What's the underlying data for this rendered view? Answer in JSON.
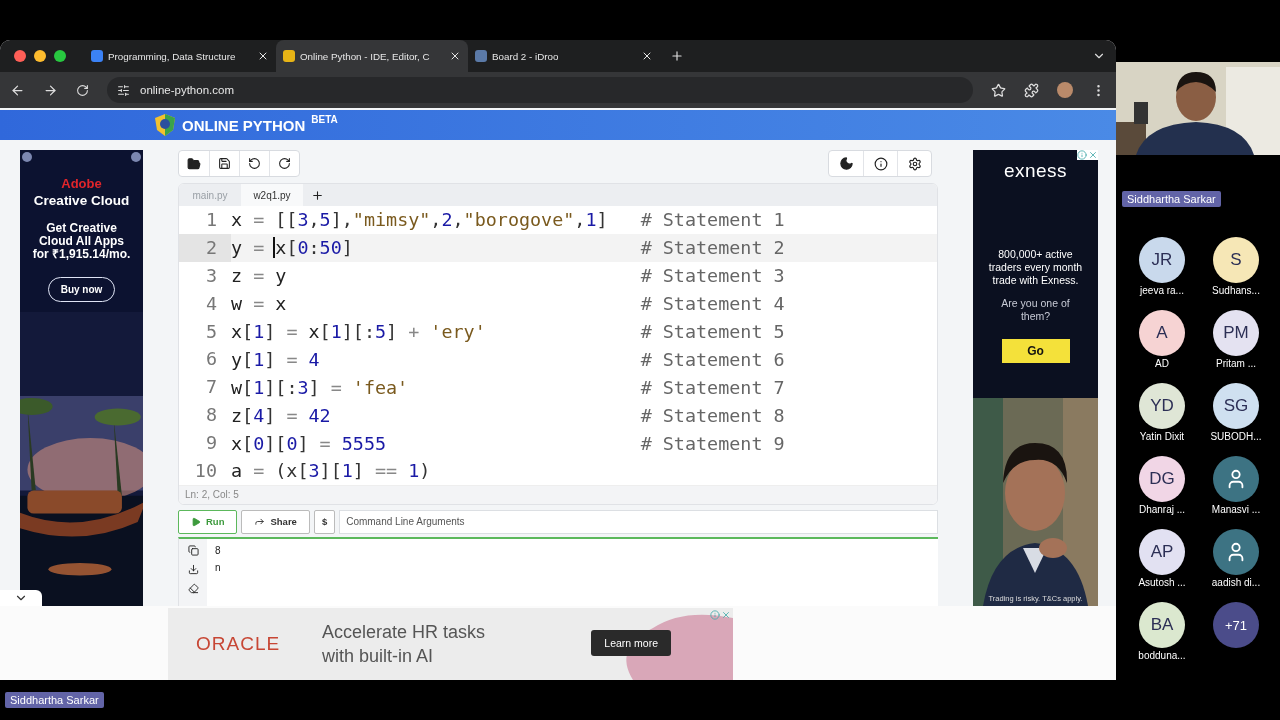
{
  "browser": {
    "tabs": [
      {
        "title": "Programming, Data Structure",
        "selected": false,
        "color": "#3b82f6"
      },
      {
        "title": "Online Python - IDE, Editor, C",
        "selected": true,
        "color": "#e7b416"
      },
      {
        "title": "Board 2 - iDroo",
        "selected": false,
        "color": "#5b7aa8"
      }
    ],
    "url": "online-python.com"
  },
  "site": {
    "brand": "ONLINE PYTHON",
    "badge": "BETA"
  },
  "left_ad": {
    "brand": "Adobe",
    "title": "Creative Cloud",
    "offer": "Get Creative Cloud All Apps for ₹1,915.14/mo.",
    "button": "Buy now"
  },
  "editor": {
    "files": [
      {
        "name": "main.py",
        "selected": false
      },
      {
        "name": "w2q1.py",
        "selected": true
      }
    ],
    "lines": [
      {
        "number": "1",
        "active": false,
        "tokens": [
          {
            "kind": "name",
            "text": "x"
          },
          {
            "kind": "op",
            "text": " = "
          },
          {
            "kind": "punct",
            "text": "[["
          },
          {
            "kind": "num",
            "text": "3"
          },
          {
            "kind": "punct",
            "text": ","
          },
          {
            "kind": "num",
            "text": "5"
          },
          {
            "kind": "punct",
            "text": "],"
          },
          {
            "kind": "str",
            "text": "\"mimsy\""
          },
          {
            "kind": "punct",
            "text": ","
          },
          {
            "kind": "num",
            "text": "2"
          },
          {
            "kind": "punct",
            "text": ","
          },
          {
            "kind": "str",
            "text": "\"borogove\""
          },
          {
            "kind": "punct",
            "text": ","
          },
          {
            "kind": "num",
            "text": "1"
          },
          {
            "kind": "punct",
            "text": "]"
          }
        ],
        "comment": "# Statement 1"
      },
      {
        "number": "2",
        "active": true,
        "tokens": [
          {
            "kind": "name",
            "text": "y"
          },
          {
            "kind": "op",
            "text": " = "
          },
          {
            "kind": "name",
            "text": "x",
            "cursor": true
          },
          {
            "kind": "punct",
            "text": "["
          },
          {
            "kind": "num",
            "text": "0"
          },
          {
            "kind": "punct",
            "text": ":"
          },
          {
            "kind": "num",
            "text": "50"
          },
          {
            "kind": "punct",
            "text": "]"
          }
        ],
        "comment": "# Statement 2"
      },
      {
        "number": "3",
        "active": false,
        "tokens": [
          {
            "kind": "name",
            "text": "z"
          },
          {
            "kind": "op",
            "text": " = "
          },
          {
            "kind": "name",
            "text": "y"
          }
        ],
        "comment": "# Statement 3"
      },
      {
        "number": "4",
        "active": false,
        "tokens": [
          {
            "kind": "name",
            "text": "w"
          },
          {
            "kind": "op",
            "text": " = "
          },
          {
            "kind": "name",
            "text": "x"
          }
        ],
        "comment": "# Statement 4"
      },
      {
        "number": "5",
        "active": false,
        "tokens": [
          {
            "kind": "name",
            "text": "x"
          },
          {
            "kind": "punct",
            "text": "["
          },
          {
            "kind": "num",
            "text": "1"
          },
          {
            "kind": "punct",
            "text": "]"
          },
          {
            "kind": "op",
            "text": " = "
          },
          {
            "kind": "name",
            "text": "x"
          },
          {
            "kind": "punct",
            "text": "["
          },
          {
            "kind": "num",
            "text": "1"
          },
          {
            "kind": "punct",
            "text": "][:"
          },
          {
            "kind": "num",
            "text": "5"
          },
          {
            "kind": "punct",
            "text": "]"
          },
          {
            "kind": "op",
            "text": " + "
          },
          {
            "kind": "str",
            "text": "'ery'"
          }
        ],
        "comment": "# Statement 5"
      },
      {
        "number": "6",
        "active": false,
        "tokens": [
          {
            "kind": "name",
            "text": "y"
          },
          {
            "kind": "punct",
            "text": "["
          },
          {
            "kind": "num",
            "text": "1"
          },
          {
            "kind": "punct",
            "text": "]"
          },
          {
            "kind": "op",
            "text": " = "
          },
          {
            "kind": "num",
            "text": "4"
          }
        ],
        "comment": "# Statement 6"
      },
      {
        "number": "7",
        "active": false,
        "tokens": [
          {
            "kind": "name",
            "text": "w"
          },
          {
            "kind": "punct",
            "text": "["
          },
          {
            "kind": "num",
            "text": "1"
          },
          {
            "kind": "punct",
            "text": "][:"
          },
          {
            "kind": "num",
            "text": "3"
          },
          {
            "kind": "punct",
            "text": "]"
          },
          {
            "kind": "op",
            "text": " = "
          },
          {
            "kind": "str",
            "text": "'fea'"
          }
        ],
        "comment": "# Statement 7"
      },
      {
        "number": "8",
        "active": false,
        "tokens": [
          {
            "kind": "name",
            "text": "z"
          },
          {
            "kind": "punct",
            "text": "["
          },
          {
            "kind": "num",
            "text": "4"
          },
          {
            "kind": "punct",
            "text": "]"
          },
          {
            "kind": "op",
            "text": " = "
          },
          {
            "kind": "num",
            "text": "42"
          }
        ],
        "comment": "# Statement 8"
      },
      {
        "number": "9",
        "active": false,
        "tokens": [
          {
            "kind": "name",
            "text": "x"
          },
          {
            "kind": "punct",
            "text": "["
          },
          {
            "kind": "num",
            "text": "0"
          },
          {
            "kind": "punct",
            "text": "]["
          },
          {
            "kind": "num",
            "text": "0"
          },
          {
            "kind": "punct",
            "text": "]"
          },
          {
            "kind": "op",
            "text": " = "
          },
          {
            "kind": "num",
            "text": "5555"
          }
        ],
        "comment": "# Statement 9"
      },
      {
        "number": "10",
        "active": false,
        "tokens": [
          {
            "kind": "name",
            "text": "a"
          },
          {
            "kind": "op",
            "text": " = "
          },
          {
            "kind": "punct",
            "text": "(x["
          },
          {
            "kind": "num",
            "text": "3"
          },
          {
            "kind": "punct",
            "text": "]["
          },
          {
            "kind": "num",
            "text": "1"
          },
          {
            "kind": "punct",
            "text": "]"
          },
          {
            "kind": "op",
            "text": " == "
          },
          {
            "kind": "num",
            "text": "1"
          },
          {
            "kind": "punct",
            "text": ")"
          }
        ]
      }
    ],
    "status": "Ln: 2,  Col: 5"
  },
  "run_bar": {
    "run": "Run",
    "share": "Share",
    "dollar": "$",
    "arguments_placeholder": "Command Line Arguments"
  },
  "output": [
    "8",
    "n"
  ],
  "right_ad": {
    "brand": "exness",
    "headline": "800,000+ active traders every month trade with Exness.",
    "question": "Are you one of them?",
    "button": "Go",
    "disclaimer": "Trading is risky. T&Cs apply."
  },
  "bottom_ad": {
    "brand": "ORACLE",
    "text": "Accelerate HR tasks with built-in AI",
    "button": "Learn more"
  },
  "meeting": {
    "speaker": "Siddhartha Sarkar",
    "participants": [
      {
        "kind": "initials",
        "initials": "JR",
        "name": "jeeva ra...",
        "color": "#c9d9ec"
      },
      {
        "kind": "initials",
        "initials": "S",
        "name": "Sudhans...",
        "color": "#f6e7b6"
      },
      {
        "kind": "initials",
        "initials": "A",
        "name": "AD",
        "color": "#f6d3d3"
      },
      {
        "kind": "initials",
        "initials": "PM",
        "name": "Pritam ...",
        "color": "#e4e2f1"
      },
      {
        "kind": "initials",
        "initials": "YD",
        "name": "Yatin Dixit",
        "color": "#dfe6d6"
      },
      {
        "kind": "initials",
        "initials": "SG",
        "name": "SUBODH...",
        "color": "#cfe0f0"
      },
      {
        "kind": "initials",
        "initials": "DG",
        "name": "Dhanraj ...",
        "color": "#f1d6e6"
      },
      {
        "kind": "icon",
        "name": "Manasvi ...",
        "color": "#3d7383"
      },
      {
        "kind": "initials",
        "initials": "AP",
        "name": "Asutosh ...",
        "color": "#e2e1f2"
      },
      {
        "kind": "icon",
        "name": "aadish di...",
        "color": "#3d7383"
      },
      {
        "kind": "initials",
        "initials": "BA",
        "name": "bodduna...",
        "color": "#dbe8cf"
      }
    ],
    "more": "+71",
    "presenter": "Siddhartha Sarkar"
  }
}
